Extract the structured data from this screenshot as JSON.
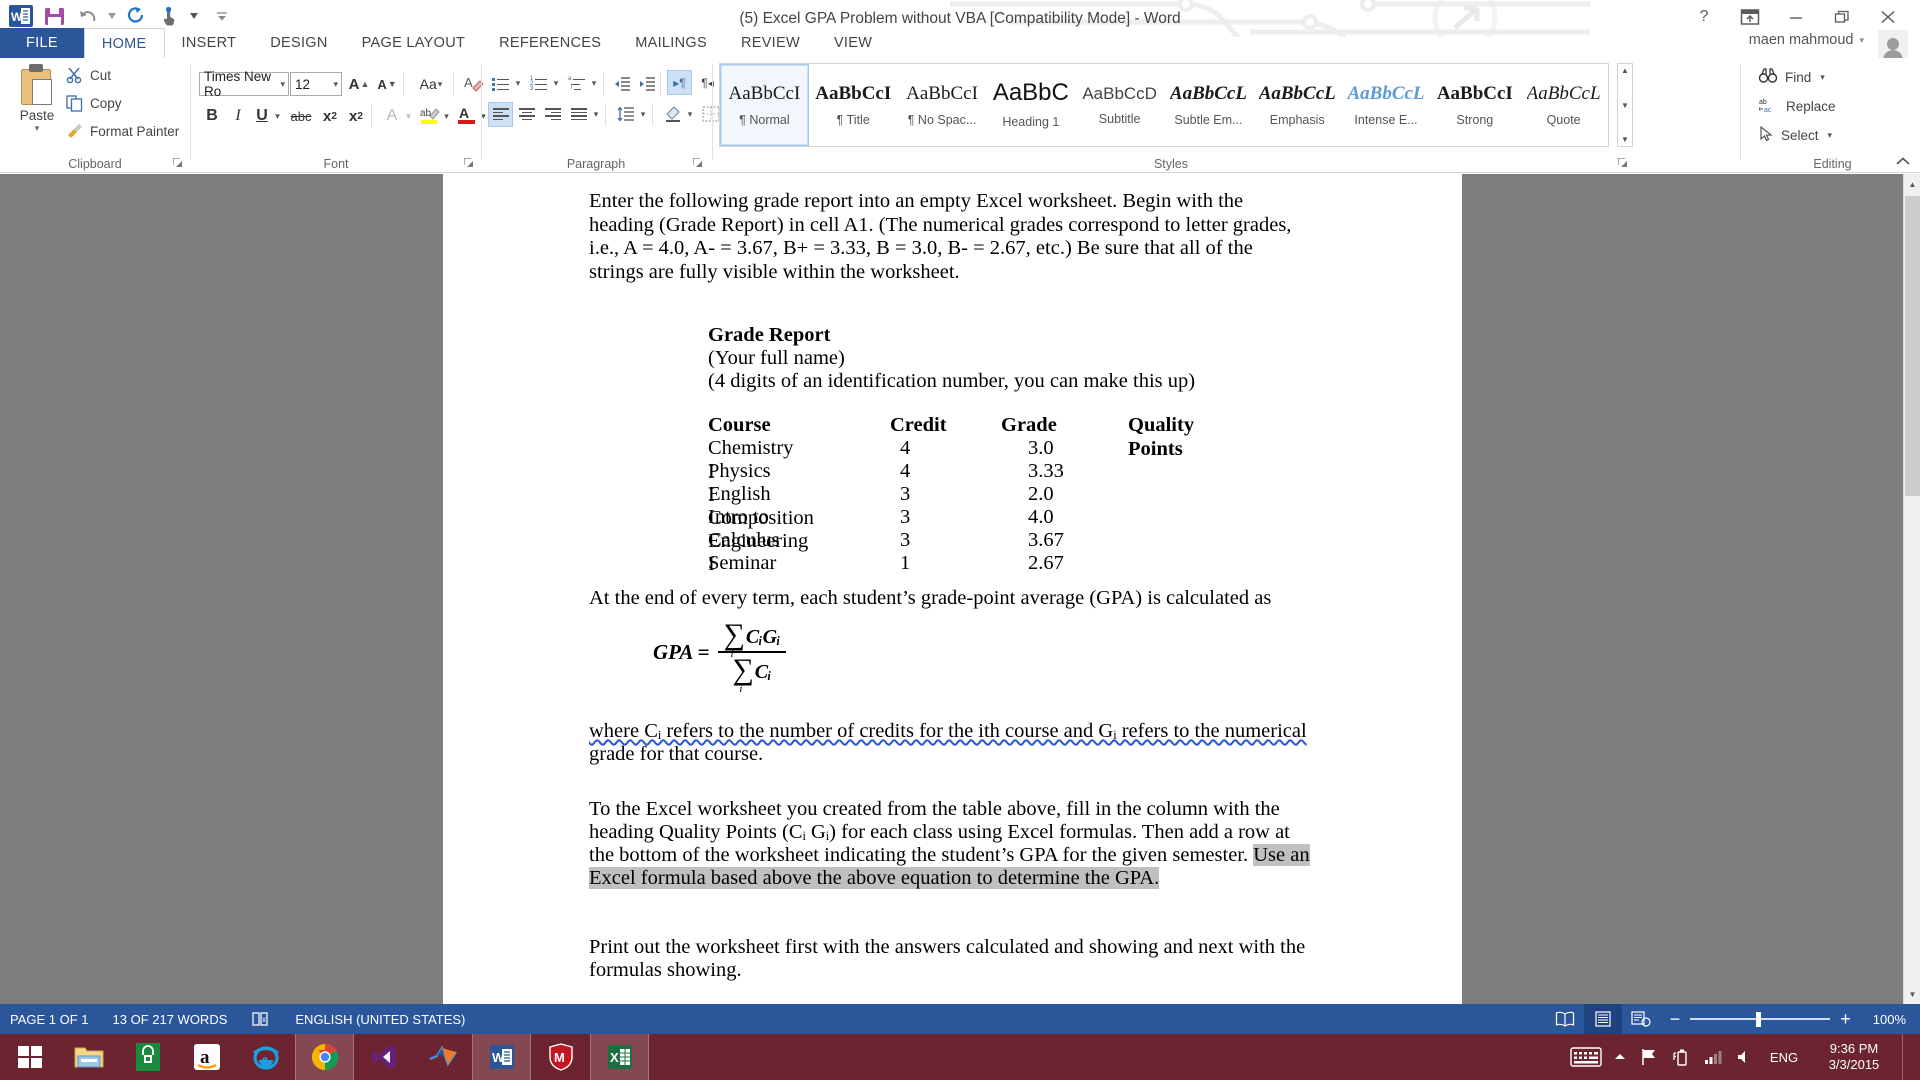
{
  "window": {
    "title": "(5) Excel GPA Problem without VBA [Compatibility Mode] - Word",
    "account_name": "maen mahmoud",
    "help_label": "?",
    "ribbon_display_label": "ribbon-display-options",
    "minimize_label": "—",
    "restore_label": "❐",
    "close_label": "✕"
  },
  "quick_access": {
    "items": [
      {
        "name": "word-logo-icon",
        "label": "W"
      },
      {
        "name": "save-icon",
        "label": "Save"
      },
      {
        "name": "undo-icon",
        "label": "Undo"
      },
      {
        "name": "redo-icon",
        "label": "Redo"
      },
      {
        "name": "touch-mode-icon",
        "label": "Touch/Mouse Mode"
      },
      {
        "name": "customize-qat-icon",
        "label": "Customize Quick Access Toolbar"
      }
    ]
  },
  "tabs": [
    {
      "label": "FILE",
      "state": "file"
    },
    {
      "label": "HOME",
      "state": "active"
    },
    {
      "label": "INSERT",
      "state": "normal"
    },
    {
      "label": "DESIGN",
      "state": "normal"
    },
    {
      "label": "PAGE LAYOUT",
      "state": "normal"
    },
    {
      "label": "REFERENCES",
      "state": "normal"
    },
    {
      "label": "MAILINGS",
      "state": "normal"
    },
    {
      "label": "REVIEW",
      "state": "normal"
    },
    {
      "label": "VIEW",
      "state": "normal"
    }
  ],
  "ribbon": {
    "clipboard": {
      "group_label": "Clipboard",
      "paste_label": "Paste",
      "cut_label": "Cut",
      "copy_label": "Copy",
      "format_painter_label": "Format Painter"
    },
    "font": {
      "group_label": "Font",
      "font_name": "Times New Ro",
      "font_size": "12",
      "grow_label": "A",
      "shrink_label": "A",
      "change_case_label": "Aa",
      "clear_formatting_label": "A",
      "bold_label": "B",
      "italic_label": "I",
      "underline_label": "U",
      "strikethrough_label": "abc",
      "subscript_label": "x",
      "superscript_label": "x",
      "text_effects_label": "A",
      "highlight_label": "ab",
      "font_color_label": "A"
    },
    "paragraph": {
      "group_label": "Paragraph",
      "bullets_label": "Bullets",
      "numbering_label": "Numbering",
      "multilevel_label": "Multilevel List",
      "decrease_indent_label": "Decrease Indent",
      "increase_indent_label": "Increase Indent",
      "ltr_label": "¶",
      "rtl_label": "¶",
      "sort_label": "Sort",
      "show_marks_label": "¶",
      "align_left_label": "Align Left",
      "center_label": "Center",
      "align_right_label": "Align Right",
      "justify_label": "Justify",
      "line_spacing_label": "Line and Paragraph Spacing",
      "shading_label": "Shading",
      "borders_label": "Borders"
    },
    "styles": {
      "group_label": "Styles",
      "items": [
        {
          "sample": "AaBbCcI",
          "name": "¶ Normal",
          "style": "normal",
          "selected": true
        },
        {
          "sample": "AaBbCcI",
          "name": "¶ Title",
          "style": "bold",
          "selected": false
        },
        {
          "sample": "AaBbCcI",
          "name": "¶ No Spac...",
          "style": "normal",
          "selected": false
        },
        {
          "sample": "AaBbC",
          "name": "Heading 1",
          "style": "heading",
          "selected": false
        },
        {
          "sample": "AaBbCcD",
          "name": "Subtitle",
          "style": "subtitle",
          "selected": false
        },
        {
          "sample": "AaBbCcL",
          "name": "Subtle Em...",
          "style": "italic",
          "selected": false
        },
        {
          "sample": "AaBbCcL",
          "name": "Emphasis",
          "style": "italic",
          "selected": false
        },
        {
          "sample": "AaBbCcL",
          "name": "Intense E...",
          "style": "italic-blue",
          "selected": false
        },
        {
          "sample": "AaBbCcI",
          "name": "Strong",
          "style": "bold",
          "selected": false
        },
        {
          "sample": "AaBbCcL",
          "name": "Quote",
          "style": "italic",
          "selected": false
        }
      ]
    },
    "editing": {
      "group_label": "Editing",
      "find_label": "Find",
      "replace_label": "Replace",
      "select_label": "Select"
    }
  },
  "document": {
    "paragraph_1": "Enter the following grade report into an empty Excel worksheet.  Begin with the heading (Grade Report) in cell A1. (The numerical grades correspond to letter grades, i.e., A = 4.0, A- = 3.67, B+ = 3.33, B = 3.0, B- = 2.67, etc.) Be sure that all of the strings are fully visible within the worksheet.",
    "report_title": "Grade Report",
    "report_line_2": "(Your full name)",
    "report_line_3": "(4 digits of an identification number, you can make this up)",
    "table": {
      "headers": [
        "Course",
        "Credit",
        "Grade",
        "Quality Points"
      ],
      "rows": [
        {
          "course": "Chemistry I",
          "credit": "4",
          "grade": "3.0",
          "quality_points": ""
        },
        {
          "course": "Physics I",
          "credit": "4",
          "grade": "3.33",
          "quality_points": ""
        },
        {
          "course": "English Composition",
          "credit": "3",
          "grade": "2.0",
          "quality_points": ""
        },
        {
          "course": "Intro to Engineering",
          "credit": "3",
          "grade": "4.0",
          "quality_points": ""
        },
        {
          "course": "Calculus I",
          "credit": "3",
          "grade": "3.67",
          "quality_points": ""
        },
        {
          "course": "Seminar",
          "credit": "1",
          "grade": "2.67",
          "quality_points": ""
        }
      ]
    },
    "paragraph_2": "At the end of every term, each student’s grade-point average (GPA) is calculated as",
    "equation": {
      "lhs": "GPA =",
      "numerator": "CᵢGᵢ",
      "denominator": "Cᵢ",
      "sum_symbol": "∑",
      "index": "i"
    },
    "paragraph_3_line_1": "where Cᵢ refers to the number of credits for the ith course and Gᵢ refers to the numerical",
    "paragraph_3_line_2": "grade for that course.",
    "paragraph_4_plain_1": "To the Excel worksheet you created from the table above, fill in the column with the",
    "paragraph_4_plain_2": "heading Quality Points (Cᵢ Gᵢ) for each class using Excel formulas.  Then add a row at",
    "paragraph_4_plain_3": "the bottom of the worksheet indicating the student’s GPA for the given semester. ",
    "paragraph_4_highlight_1": "Use an",
    "paragraph_4_highlight_2": "Excel formula based above the above equation to determine the GPA.",
    "paragraph_5_line_1": "Print out the worksheet first with the answers calculated and showing and next with the",
    "paragraph_5_line_2": "formulas showing."
  },
  "status_bar": {
    "page_label": "PAGE 1 OF 1",
    "words_label": "13 OF 217 WORDS",
    "proofing_label": "proofing-errors-icon",
    "language_label": "ENGLISH (UNITED STATES)",
    "read_mode_label": "Read Mode",
    "print_layout_label": "Print Layout",
    "web_layout_label": "Web Layout",
    "zoom_out_label": "−",
    "zoom_in_label": "+",
    "zoom_level": "100%"
  },
  "taskbar": {
    "items": [
      {
        "name": "start-button",
        "label": "Start",
        "open": false
      },
      {
        "name": "file-explorer-icon",
        "label": "File Explorer",
        "open": false
      },
      {
        "name": "windows-store-icon",
        "label": "Store",
        "open": false
      },
      {
        "name": "amazon-icon",
        "label": "Amazon",
        "open": false
      },
      {
        "name": "internet-explorer-icon",
        "label": "Internet Explorer",
        "open": false
      },
      {
        "name": "google-chrome-icon",
        "label": "Google Chrome",
        "open": true
      },
      {
        "name": "visual-studio-icon",
        "label": "Visual Studio",
        "open": false
      },
      {
        "name": "matlab-icon",
        "label": "MATLAB",
        "open": false
      },
      {
        "name": "word-icon",
        "label": "Word",
        "open": true
      },
      {
        "name": "mcafee-icon",
        "label": "McAfee",
        "open": false
      },
      {
        "name": "excel-icon",
        "label": "Excel",
        "open": true
      }
    ],
    "tray": {
      "keyboard_label": "Touch Keyboard",
      "show_hidden_label": "Show hidden icons",
      "flag_label": "Action Center",
      "battery_label": "Battery",
      "network_label": "Network",
      "volume_label": "Volume",
      "language_label": "ENG",
      "time": "9:36 PM",
      "date": "3/3/2015"
    }
  },
  "colors": {
    "word_blue": "#2b579a",
    "status_blue": "#2b579a",
    "taskbar": "#6b2430",
    "highlight_gray": "#c0c0c0",
    "page_gray": "#7d7d7d"
  }
}
